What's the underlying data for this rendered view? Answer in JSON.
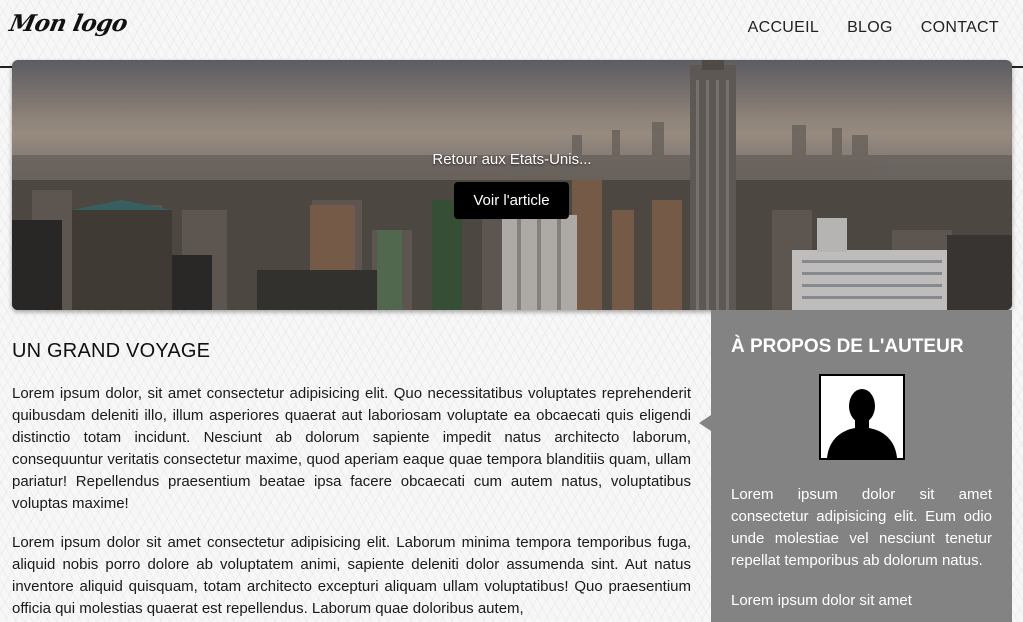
{
  "header": {
    "logo": "Mon logo",
    "nav": [
      {
        "label": "ACCUEIL"
      },
      {
        "label": "BLOG"
      },
      {
        "label": "CONTACT"
      }
    ]
  },
  "hero": {
    "caption": "Retour aux Etats-Unis...",
    "button_label": "Voir l'article"
  },
  "article": {
    "title": "UN GRAND VOYAGE",
    "paragraphs": [
      "Lorem ipsum dolor, sit amet consectetur adipisicing elit. Quo necessitatibus voluptates reprehenderit quibusdam deleniti illo, illum asperiores quaerat aut laboriosam voluptate ea obcaecati quis eligendi distinctio totam incidunt. Nesciunt ab dolorum sapiente impedit natus architecto laborum, consequuntur veritatis consectetur maxime, quod aperiam eaque quae tempora blanditiis quam, ullam pariatur! Repellendus praesentium beatae ipsa facere obcaecati cum autem natus, voluptatibus voluptas maxime!",
      "Lorem ipsum dolor sit amet consectetur adipisicing elit. Laborum minima tempora temporibus fuga, aliquid nobis porro dolore ab voluptatem animi, sapiente deleniti dolor assumenda sint. Aut natus inventore aliquid quisquam, totam architecto excepturi aliquam ullam voluptatibus! Quo praesentium officia qui molestias quaerat est repellendus. Laborum quae doloribus autem,"
    ]
  },
  "sidebar": {
    "title": "À PROPOS DE L'AUTEUR",
    "paragraphs": [
      "Lorem ipsum dolor sit amet consectetur adipisicing elit. Eum odio unde molestiae vel nesciunt tenetur repellat temporibus ab dolorum natus.",
      "Lorem ipsum dolor sit amet"
    ]
  },
  "colors": {
    "sidebar_bg": "#838383",
    "button_bg": "#000000",
    "header_rule": "#222222"
  },
  "icons": {
    "avatar": "person-silhouette-icon"
  }
}
